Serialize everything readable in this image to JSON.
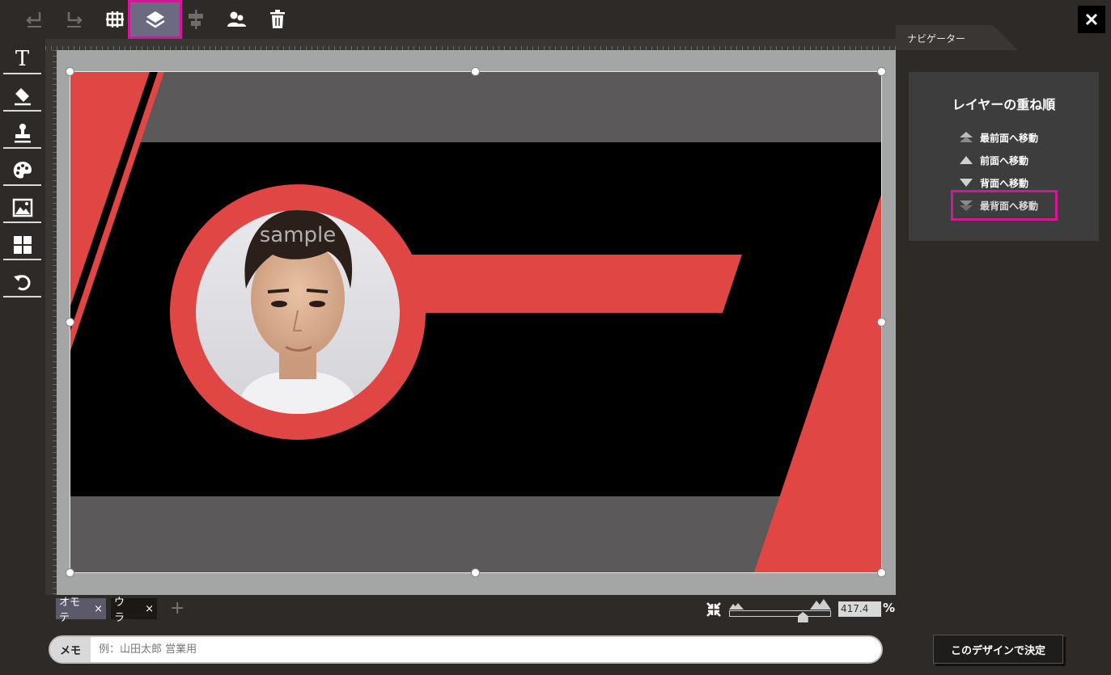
{
  "toolbar": {
    "undo_icon": "undo-icon",
    "redo_icon": "redo-icon",
    "grid_icon": "grid-icon",
    "layers_icon": "layers-icon",
    "align_icon": "align-icon",
    "person_icon": "person-icon",
    "trash_icon": "trash-icon",
    "close_icon": "close-icon",
    "active_tool": "layers"
  },
  "left_tools": [
    {
      "name": "text-tool",
      "label": "T"
    },
    {
      "name": "eraser-tool"
    },
    {
      "name": "stamp-tool"
    },
    {
      "name": "palette-tool"
    },
    {
      "name": "image-tool"
    },
    {
      "name": "layout-tool"
    },
    {
      "name": "rotate-tool"
    }
  ],
  "navigator": {
    "tab_label": "ナビゲーター",
    "layer_order": {
      "title": "レイヤーの重ね順",
      "items": [
        {
          "label": "最前面へ移動",
          "icon": "bring-to-front-icon"
        },
        {
          "label": "前面へ移動",
          "icon": "bring-forward-icon"
        },
        {
          "label": "背面へ移動",
          "icon": "send-backward-icon"
        },
        {
          "label": "最背面へ移動",
          "icon": "send-to-back-icon",
          "highlighted": true
        }
      ]
    }
  },
  "design": {
    "watermark": "sample",
    "colors": {
      "accent": "#e04644",
      "band": "#5b5959",
      "background": "#000000"
    }
  },
  "pages": {
    "tabs": [
      {
        "label": "オモテ",
        "close": "×",
        "active": true
      },
      {
        "label": "ウラ",
        "close": "×",
        "active": false
      }
    ],
    "add_label": "+"
  },
  "zoom": {
    "value": "417.4",
    "unit": "%",
    "level_fraction": 0.75
  },
  "memo": {
    "label": "メモ",
    "placeholder": "例：山田太郎 営業用",
    "value": ""
  },
  "decide_button": "このデザインで決定"
}
